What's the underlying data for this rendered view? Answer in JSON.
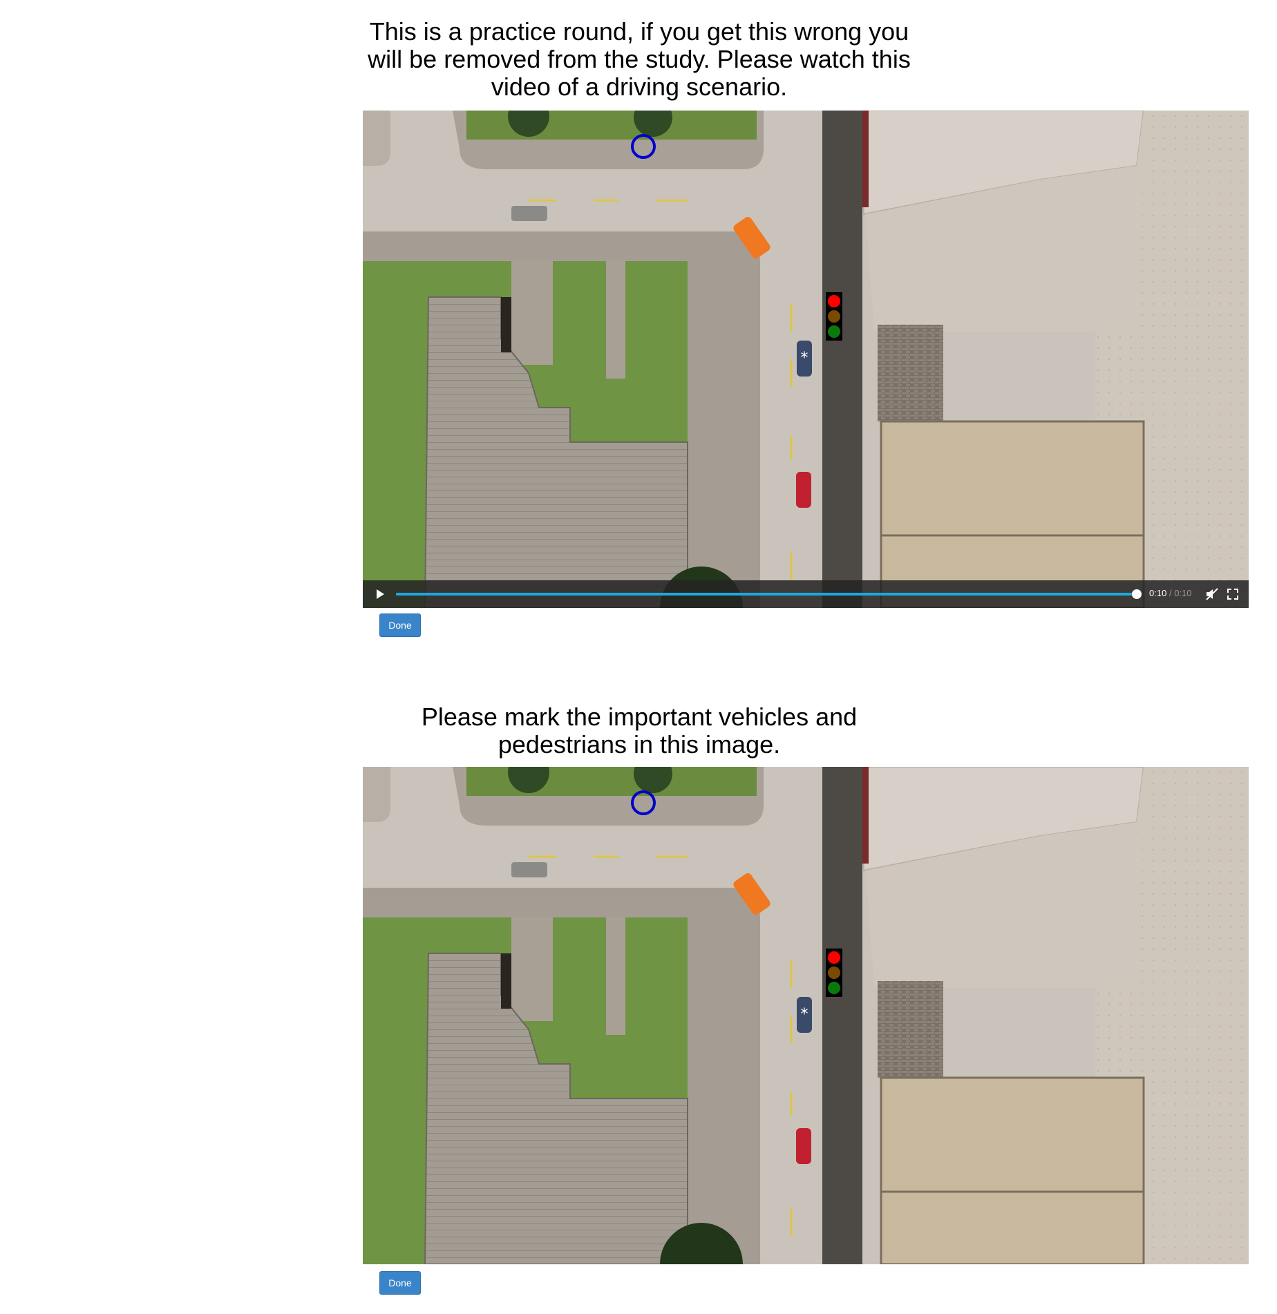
{
  "practice": {
    "prompt": "This is a practice round, if you get this wrong you will be removed from the study. Please watch this video of a driving scenario.",
    "done_label": "Done",
    "video": {
      "current_time": "0:10",
      "separator": "/",
      "duration": "0:10",
      "progress": 1.0,
      "icons": [
        "play-icon",
        "mute-icon",
        "fullscreen-icon"
      ]
    }
  },
  "annotate": {
    "prompt": "Please mark the important vehicles and pedestrians in this image.",
    "done_label": "Done"
  },
  "scene": {
    "traffic_light": {
      "states": [
        "red",
        "amber",
        "green"
      ],
      "colors": [
        "#ff0000",
        "#7a4a00",
        "#0a7a0a"
      ]
    },
    "marker_color": "#0000cc",
    "vehicle_colors": {
      "van": "#f07820",
      "ego": "#3a4a6a",
      "red_car": "#c02030",
      "parked": "#8a8a86"
    }
  },
  "colors": {
    "button": "#3a84c9",
    "progress": "#1ea7e0",
    "controls_bg": "#232323"
  }
}
